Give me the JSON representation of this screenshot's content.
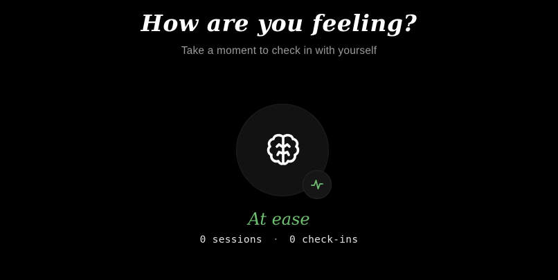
{
  "header": {
    "title": "How are you feeling?",
    "subtitle": "Take a moment to check in with yourself"
  },
  "orb": {
    "icon": "brain-icon",
    "badge_icon": "pulse-icon"
  },
  "mood": {
    "label": "At ease",
    "color": "#6fbf73"
  },
  "stats": {
    "sessions": "0 sessions",
    "separator": "·",
    "checkins": "0 check-ins"
  },
  "colors": {
    "background": "#000000",
    "accent": "#6fbf73",
    "muted_text": "#9a9a9a"
  }
}
